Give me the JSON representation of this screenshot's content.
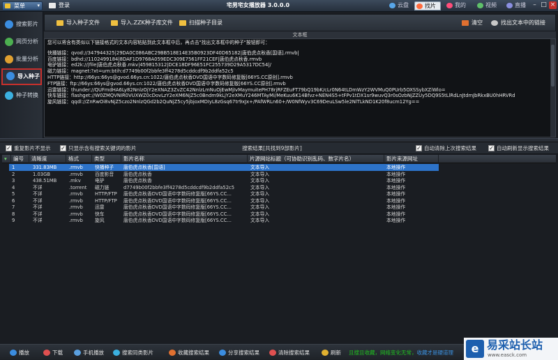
{
  "titlebar": {
    "menu_label": "菜单",
    "login_label": "登录",
    "app_title": "宅男宅女播放器 3.0.0.0",
    "tabs": [
      {
        "label": "云盘",
        "color": "#58a6e8"
      },
      {
        "label": "找片",
        "color": "#ff6b3d"
      },
      {
        "label": "我的",
        "color": "#ff4d7a"
      },
      {
        "label": "视频",
        "color": "#5fc06a"
      },
      {
        "label": "直播",
        "color": "#8a8fe0"
      }
    ]
  },
  "sidebar": {
    "items": [
      {
        "label": "搜索影片",
        "color": "#3b8de0"
      },
      {
        "label": "网页分析",
        "color": "#4caf50"
      },
      {
        "label": "批量分析",
        "color": "#e0a030"
      },
      {
        "label": "导入种子",
        "color": "#3b8de0"
      },
      {
        "label": "种子转换",
        "color": "#3bb0e0"
      }
    ]
  },
  "toolbar": {
    "import_torrent": "导入种子文件",
    "import_zzk": "导入.ZZK种子库文件",
    "scan_dir": "扫描种子目录",
    "clear": "清空",
    "extract_links": "找出文本中的链接"
  },
  "textframe": {
    "label": "文本框",
    "intro": "您可以将含有类似以下链接格式的文本内容粘贴到此文本框中后，再点击\"找出文本框中的种子\"按钮即可：",
    "lines": [
      "快播链接：qvod://347944325|29DA0C086ABC29BB518E14E35B0923DF40D65182|唐伯虎点秋香[国语].rmvb|",
      "百度链接：bdhd://1102499184|8DAF1D9768A059EDC309E7561FF21CEF|唐伯虎点秋香.rmvb",
      "电驴链接：ed2k://|file|唐伯虎点秋香.mkv|459815312|DCE18DF96E51FC255739D29A5317DC54|/",
      "磁力链接：magnet:?xt=urn:btih:d7749b00f2bbfe3ff4278d5cddcdf9b2ddfa52c5",
      "HTTP链接：http://66ys:66ys@gvod.66ys.cn:1022/唐伯虎点秋香DVD国语中字数码修复版[66YS.CC原创].rmvb",
      "FTP链接：ftp://66ys:66ys@gvod.66ys.cn:1022/唐伯虎点秋香DVD国语中字数码修复版[66YS.CC原创].rmvb",
      "迅雷链接：thunder://QUFmdHA6Ly82NnlzOjY2eXNAZ3ZvZC42NnlzLmNuOjEwMjIvMaymuitePH78rjRFZEuFT79bQ19bK/cLr0N64tLDmWzY2WVMuQ0PUrb5OXSSybXZiWlo=",
      "快车链接：flashget://W0ZMQVNIR0VUXWZ0cDovLzY2eXM6NjZ5c0Bndm9kLjY2eXMuY246MTAyMi/MeKuu6K14Bfvz+NEN4S5+tFPv1tDX1sr9wuvQ3r0sOzbNjZZUy5DQ9S5tLlRdLnJtdmJbRkxBU0hHRVRd",
      "旋风链接：qqdl://ZnRwOi8vNjZ5czo2NnlzQGd2b2QuNjZ5cy5jbjoxMDIyL8zGsq67tr9xJx+/PAfWRLn60+/W0NfWyv3C69DeuLSw5le2NlTLkND1K20f8ucm12Yg=="
    ]
  },
  "options": {
    "dup_label": "重复影片不显示",
    "keyword_label": "只显示含有搜索关键词的影片",
    "result_title": "搜索结果[共找到9部影片]",
    "auto_clear_label": "自动清除上次搜索结果",
    "auto_refresh_label": "自动刷新显示搜索结果"
  },
  "table": {
    "headers": [
      "编号",
      "清晰度",
      "格式",
      "类型",
      "影片名称",
      "片源网站标题（可协助识别乱码、数字片名）",
      "影片来源网址"
    ],
    "rows": [
      [
        "1",
        "331.83MB",
        ".rmvb",
        "快播种子",
        "唐伯虎点秋香[国语]",
        "文本导入",
        "本地操作"
      ],
      [
        "2",
        "1.03GB",
        ".rmvb",
        "百度影音",
        "唐伯虎点秋香",
        "文本导入",
        "本地操作"
      ],
      [
        "3",
        "438.51MB",
        ".mkv",
        "电驴",
        "唐伯虎点秋香",
        "文本导入",
        "本地操作"
      ],
      [
        "4",
        "不详",
        ".torrent",
        "磁力链",
        "d7749b00f2bbfe3ff4278d5cddcdf9b2ddfa52c5",
        "文本导入",
        "本地操作"
      ],
      [
        "5",
        "不详",
        ".rmvb",
        "HTTP/FTP",
        "唐伯虎点秋香DVD国语中字数码修复版[66YS.CC...",
        "文本导入",
        "本地操作"
      ],
      [
        "6",
        "不详",
        ".rmvb",
        "HTTP/FTP",
        "唐伯虎点秋香DVD国语中字数码修复版[66YS.CC...",
        "文本导入",
        "本地操作"
      ],
      [
        "7",
        "不详",
        ".rmvb",
        "迅雷",
        "唐伯虎点秋香DVD国语中字数码修复版[66YS.CC...",
        "文本导入",
        "本地操作"
      ],
      [
        "8",
        "不详",
        ".rmvb",
        "快车",
        "唐伯虎点秋香DVD国语中字数码修复版[66YS.CC...",
        "文本导入",
        "本地操作"
      ],
      [
        "9",
        "不详",
        ".rmvb",
        "旋风",
        "唐伯虎点秋香DVD国语中字数码修复版[66YS.CC...",
        "文本导入",
        "本地操作"
      ]
    ]
  },
  "bottombar": {
    "buttons": [
      {
        "label": "播放",
        "color": "#3b8de0"
      },
      {
        "label": "下载",
        "color": "#e05050"
      },
      {
        "label": "手机播放",
        "color": "#5aa0e0"
      },
      {
        "label": "搜索同类影片",
        "color": "#3bb0e0"
      },
      {
        "label": "收藏搜索结果",
        "color": "#e07030"
      },
      {
        "label": "分享搜索结果",
        "color": "#3b8de0"
      },
      {
        "label": "清除搜索结果",
        "color": "#e05050"
      },
      {
        "label": "刷新",
        "color": "#e0b030"
      }
    ],
    "promo_green": "且搜且收藏，网络变化无常，",
    "promo_blue": "收藏才是硬道理"
  },
  "watermark": {
    "logo_char": "e",
    "name": "易采站长站",
    "url": "www.easck.com"
  }
}
